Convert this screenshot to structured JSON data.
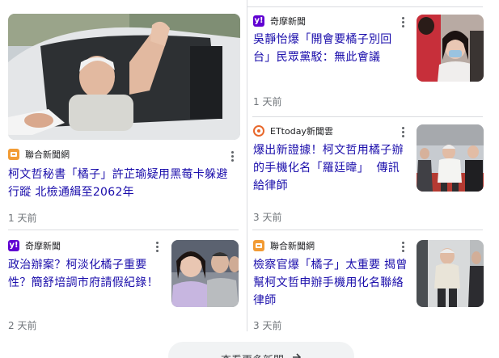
{
  "articles": [
    {
      "source": "聯合新聞網",
      "source_logo": "udn-logo",
      "source_color": "#f29b34",
      "headline_lines": [
        "柯文哲秘書「橘子」許芷瑜疑用黑莓卡躲避",
        "行蹤 北檢通緝至2062年"
      ],
      "time": "1 天前",
      "thumb": "ko-wave-in-car-photo"
    },
    {
      "source": "奇摩新聞",
      "source_logo": "yahoo-logo",
      "source_color": "#6001d2",
      "headline_lines": [
        "吳靜怡爆「開會要橘子別回",
        "台」民眾黨駁：無此會議"
      ],
      "time": "1 天前",
      "thumb": "masked-woman-photo"
    },
    {
      "source": "ETtoday新聞雲",
      "source_logo": "ettoday-logo",
      "source_color": "#e8682c",
      "headline_lines": [
        "爆出新證據！柯文哲用橘子辦",
        "的手機化名「羅廷暐」  傳訊",
        "給律師"
      ],
      "time": "3 天前",
      "thumb": "ko-walking-photo"
    },
    {
      "source": "奇摩新聞",
      "source_logo": "yahoo-logo",
      "source_color": "#6001d2",
      "headline_lines": [
        "政治辦案？柯淡化橘子重要",
        "性？簡舒培調市府請假紀錄！"
      ],
      "time": "2 天前",
      "thumb": "woman-and-men-photo"
    },
    {
      "source": "聯合新聞網",
      "source_logo": "udn-logo",
      "source_color": "#f29b34",
      "headline_lines": [
        "檢察官爆「橘子」太重要 揭曾",
        "幫柯文哲申辦手機用化名聯絡",
        "律師"
      ],
      "time": "3 天前",
      "thumb": "ko-in-hallway-photo"
    }
  ],
  "more_news": {
    "label": "查看更多新聞",
    "icon": "arrow-right-icon"
  }
}
